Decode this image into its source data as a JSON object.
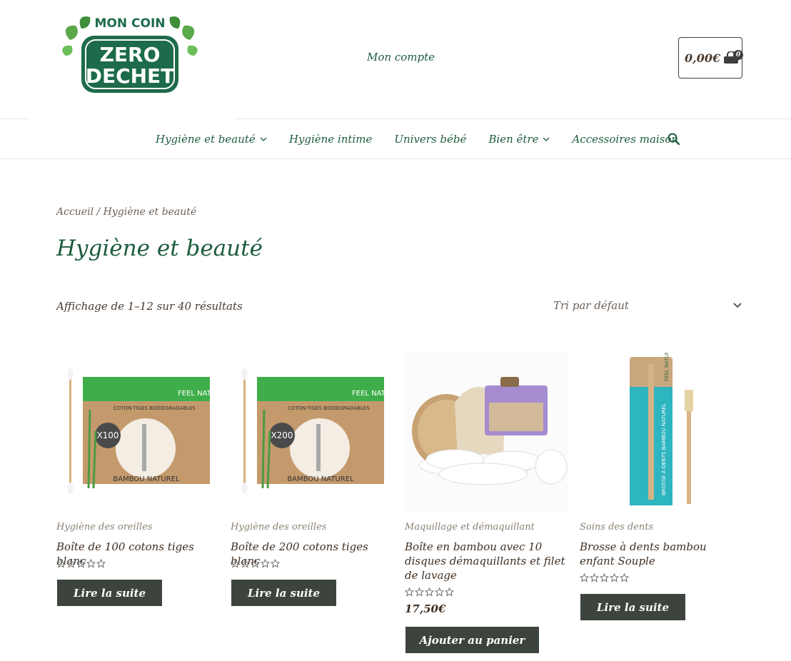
{
  "header": {
    "logo_text": [
      "MON COIN",
      "ZERO",
      "DECHET"
    ],
    "account_label": "Mon compte",
    "cart_total": "0,00€",
    "cart_count": "0"
  },
  "nav": {
    "items": [
      {
        "label": "Hygiène et beauté",
        "has_dropdown": true
      },
      {
        "label": "Hygiène intime",
        "has_dropdown": false
      },
      {
        "label": "Univers bébé",
        "has_dropdown": false
      },
      {
        "label": "Bien être",
        "has_dropdown": true
      },
      {
        "label": "Accessoires maison",
        "has_dropdown": false
      }
    ],
    "search_icon": "search-icon"
  },
  "breadcrumb": "Accueil / Hygiène et beauté",
  "page_title": "Hygiène et beauté",
  "result_count": "Affichage de 1–12 sur 40 résultats",
  "sort": {
    "selected": "Tri par défaut"
  },
  "products": [
    {
      "category": "Hygiène des oreilles",
      "title": "Boîte de 100 cotons tiges blanc",
      "price": "",
      "button": "Lire la suite",
      "badge": "X100",
      "brand": "FEEL NATURAL",
      "subtitle": "COTON-TIGES BIODEGRADABLES",
      "footer": "BAMBOU NATUREL",
      "rating": 0
    },
    {
      "category": "Hygiène des oreilles",
      "title": "Boîte de 200 cotons tiges blanc",
      "price": "",
      "button": "Lire la suite",
      "badge": "X200",
      "brand": "FEEL NATURAL",
      "subtitle": "COTON-TIGES BIODEGRADABLES",
      "footer": "BAMBOU NATUREL",
      "rating": 0
    },
    {
      "category": "Maquillage et démaquillant",
      "title": "Boîte en bambou avec 10 disques démaquillants et filet de lavage",
      "price": "17,50€",
      "button": "Ajouter au panier",
      "rating": 0
    },
    {
      "category": "Soins des dents",
      "title": "Brosse à dents bambou enfant Souple",
      "price": "",
      "button": "Lire la suite",
      "brand": "FEEL NATURAL",
      "package_text": "BROSSE À DENTS BAMBOU NATUREL",
      "rating": 0
    }
  ],
  "colors": {
    "brand_green": "#1d5c3e",
    "button_bg": "#3d443d",
    "text_brown": "#4a3a2e",
    "muted": "#8a7f72"
  }
}
